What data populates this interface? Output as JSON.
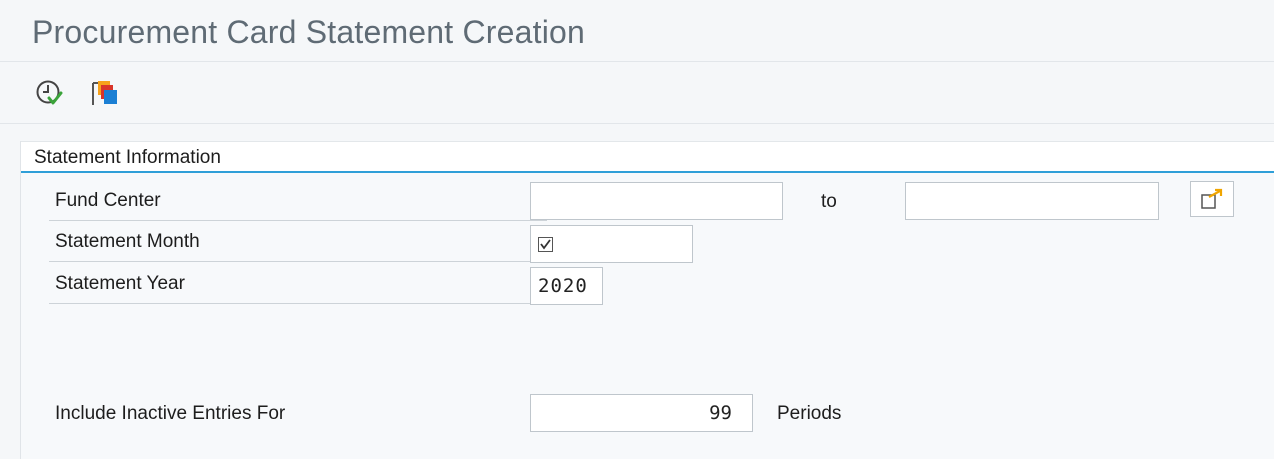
{
  "window": {
    "title": "Procurement Card Statement Creation"
  },
  "toolbar": {
    "items": [
      {
        "icon": "execute-icon",
        "label": ""
      },
      {
        "icon": "variant-icon",
        "label": ""
      }
    ]
  },
  "statement_information": {
    "header": "Statement Information",
    "fund_center": {
      "label": "Fund Center",
      "from_value": "",
      "to_label": "to",
      "to_value": ""
    },
    "statement_month": {
      "label": "Statement Month",
      "value": ""
    },
    "statement_year": {
      "label": "Statement Year",
      "value": "2020"
    },
    "inactive_entries": {
      "label": "Include Inactive Entries For",
      "value": "99",
      "unit": "Periods"
    }
  },
  "colors": {
    "accent": "#2f9fd8",
    "title_text": "#5f6b75",
    "execute_green": "#3aa33a",
    "variant_orange": "#f7a21b",
    "variant_red": "#d9352a",
    "variant_blue": "#1b7fd4"
  }
}
